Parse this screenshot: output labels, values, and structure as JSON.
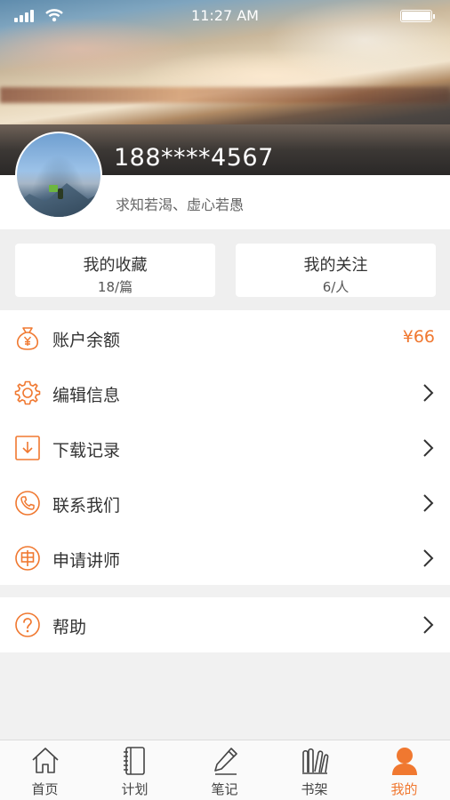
{
  "status_bar": {
    "time": "11:27 AM"
  },
  "profile": {
    "phone": "188****4567",
    "motto": "求知若渴、虚心若愚"
  },
  "stats": [
    {
      "title": "我的收藏",
      "value": "18/篇"
    },
    {
      "title": "我的关注",
      "value": "6/人"
    }
  ],
  "menu": [
    {
      "label": "账户余额",
      "icon": "money-bag-icon",
      "amount": "¥66"
    },
    {
      "label": "编辑信息",
      "icon": "gear-icon"
    },
    {
      "label": "下载记录",
      "icon": "download-icon"
    },
    {
      "label": "联系我们",
      "icon": "phone-icon"
    },
    {
      "label": "申请讲师",
      "icon": "apply-icon"
    }
  ],
  "help": {
    "label": "帮助",
    "icon": "help-icon"
  },
  "tabbar": [
    {
      "label": "首页",
      "icon": "home-icon"
    },
    {
      "label": "计划",
      "icon": "notebook-icon"
    },
    {
      "label": "笔记",
      "icon": "pen-icon"
    },
    {
      "label": "书架",
      "icon": "books-icon"
    },
    {
      "label": "我的",
      "icon": "user-icon",
      "active": true
    }
  ],
  "colors": {
    "accent": "#f07830",
    "text": "#333333",
    "background": "#f1f1f1"
  }
}
